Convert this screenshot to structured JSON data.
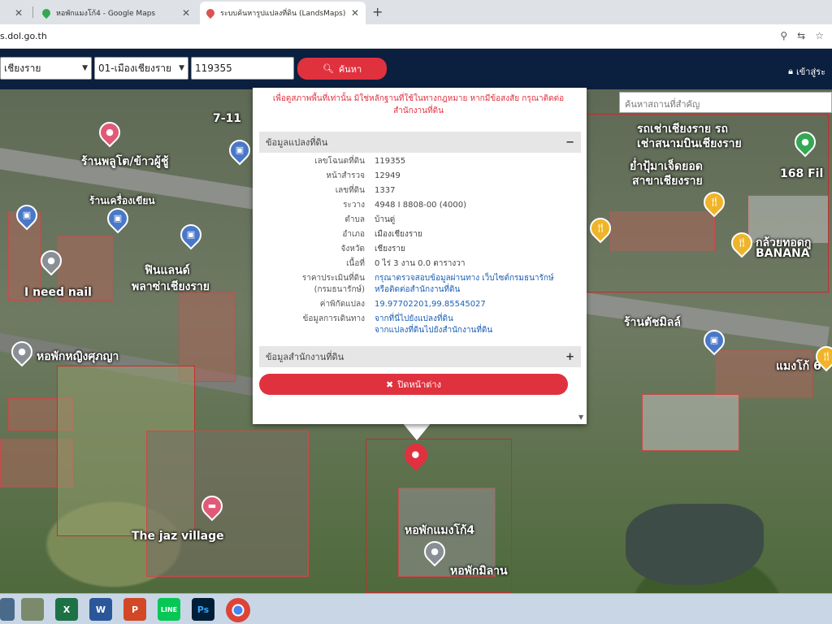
{
  "browser": {
    "tabs": [
      {
        "title": "หอพักแมงโก้4 - Google Maps",
        "active": false
      },
      {
        "title": "ระบบค้นหารูปแปลงที่ดิน (LandsMaps)",
        "active": true
      }
    ],
    "url": "s.dol.go.th"
  },
  "search_bar": {
    "province": "เชียงราย",
    "district": "01-เมืองเชียงราย",
    "parcel_no": "119355",
    "search_label": "ค้นหา",
    "login_label": "เข้าสู่ระ"
  },
  "map": {
    "search_placeholder": "ค้นหาสถานที่สำคัญ",
    "labels": {
      "seven_eleven": "7-11",
      "shop1": "ร้านพลูโต/ข้าวผู้ชู้",
      "shop2": "ร้านเครื่องเขียน",
      "need_nail": "I need nail",
      "hostel_yingsuda": "หอพักหญิงศุภญา",
      "finland": "ฟินแลนด์",
      "finland2": "พลาซ่าเชียงราย",
      "car_rent1": "รถเช่าเชียงราย รถ",
      "car_rent2": "เช่าสนามบินเชียงราย",
      "pork1": "ย่ำปุ้มาเจ็ดยอด",
      "pork2": "สาขาเชียงราย",
      "fil": "168 Fil",
      "banana1": "กล้วยทอดกู",
      "banana2": "BANANA",
      "shop_right1": "ร้านตัชมิลล์",
      "mango": "แมงโก้ 6",
      "jaz_village": "The jaz village",
      "mango4": "หอพักแมงโก้4",
      "milan": "หอพักมิลาน"
    }
  },
  "popup": {
    "warning": "เพื่อดูสภาพพื้นที่เท่านั้น มิใช่หลักฐานที่ใช้ในทางกฎหมาย หากมีข้อสงสัย กรุณาติดต่อสำนักงานที่ดิน",
    "section1_title": "ข้อมูลแปลงที่ดิน",
    "section1_toggle": "−",
    "rows": [
      {
        "k": "เลขโฉนดที่ดิน",
        "v": "119355"
      },
      {
        "k": "หน้าสำรวจ",
        "v": "12949"
      },
      {
        "k": "เลขที่ดิน",
        "v": "1337"
      },
      {
        "k": "ระวาง",
        "v": "4948 I 8808-00 (4000)"
      },
      {
        "k": "ตำบล",
        "v": "บ้านดู่"
      },
      {
        "k": "อำเภอ",
        "v": "เมืองเชียงราย"
      },
      {
        "k": "จังหวัด",
        "v": "เชียงราย"
      },
      {
        "k": "เนื้อที่",
        "v": "0 ไร่ 3 งาน 0.0 ตารางวา"
      }
    ],
    "price_label1": "ราคาประเมินที่ดิน",
    "price_label2": "(กรมธนารักษ์)",
    "price_value1": "กรุณาตรวจสอบข้อมูลผ่านทาง เว็บไซต์กรมธนารักษ์",
    "price_value2": "หรือติดต่อสำนักงานที่ดิน",
    "coord_label": "ค่าพิกัดแปลง",
    "coord_value": "19.97702201,99.85545027",
    "route_label": "ข้อมูลการเดินทาง",
    "route_value1": "จากที่นี่ไปยังแปลงที่ดิน",
    "route_value2": "จากแปลงที่ดินไปยังสำนักงานที่ดิน",
    "section2_title": "ข้อมูลสำนักงานที่ดิน",
    "section2_toggle": "+",
    "close_label": "ปิดหน้าต่าง"
  },
  "taskbar": {
    "apps": [
      "X",
      "W",
      "P",
      "LINE",
      "Ps"
    ]
  }
}
